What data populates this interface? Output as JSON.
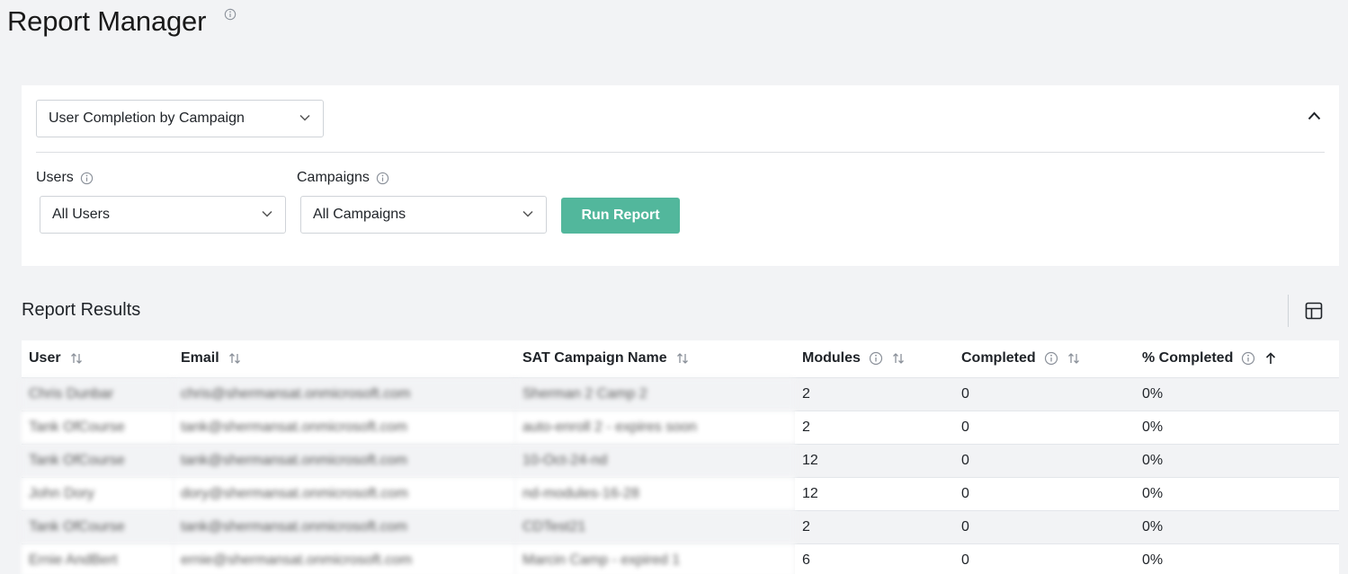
{
  "page": {
    "title": "Report Manager"
  },
  "filters": {
    "report_type": "User Completion by Campaign",
    "users_label": "Users",
    "users_value": "All Users",
    "campaigns_label": "Campaigns",
    "campaigns_value": "All Campaigns",
    "run_button": "Run Report"
  },
  "results": {
    "title": "Report Results",
    "columns": [
      "User",
      "Email",
      "SAT Campaign Name",
      "Modules",
      "Completed",
      "% Completed"
    ],
    "rows": [
      {
        "user": "Chris Dunbar",
        "email": "chris@shermansat.onmicrosoft.com",
        "campaign": "Sherman 2 Camp 2",
        "modules": "2",
        "completed": "0",
        "pct": "0%"
      },
      {
        "user": "Tank OfCourse",
        "email": "tank@shermansat.onmicrosoft.com",
        "campaign": "auto-enroll 2 - expires soon",
        "modules": "2",
        "completed": "0",
        "pct": "0%"
      },
      {
        "user": "Tank OfCourse",
        "email": "tank@shermansat.onmicrosoft.com",
        "campaign": "10-Oct-24-nd",
        "modules": "12",
        "completed": "0",
        "pct": "0%"
      },
      {
        "user": "John Dory",
        "email": "dory@shermansat.onmicrosoft.com",
        "campaign": "nd-modules-16-28",
        "modules": "12",
        "completed": "0",
        "pct": "0%"
      },
      {
        "user": "Tank OfCourse",
        "email": "tank@shermansat.onmicrosoft.com",
        "campaign": "CDTest21",
        "modules": "2",
        "completed": "0",
        "pct": "0%"
      },
      {
        "user": "Ernie AndBert",
        "email": "ernie@shermansat.onmicrosoft.com",
        "campaign": "Marcin Camp - expired 1",
        "modules": "6",
        "completed": "0",
        "pct": "0%"
      }
    ]
  },
  "icons": {
    "info": "info-circle-icon",
    "chevron": "chevron-down-icon",
    "collapse": "chevron-up-icon",
    "sort": "sort-arrows-icon",
    "sorted_asc": "arrow-up-icon",
    "columns": "table-columns-icon"
  },
  "colors": {
    "accent": "#52b79c",
    "background": "#f2f3f5",
    "panel": "#ffffff"
  }
}
